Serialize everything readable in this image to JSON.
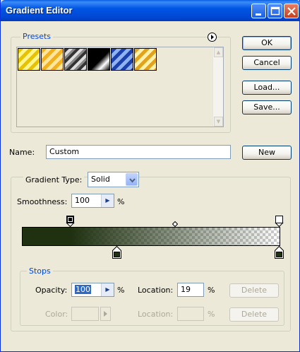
{
  "window": {
    "title": "Gradient Editor"
  },
  "presets": {
    "label": "Presets",
    "swatches": [
      {
        "name": "yellow-stripes"
      },
      {
        "name": "orange-stripes"
      },
      {
        "name": "silver-stripes"
      },
      {
        "name": "black-white"
      },
      {
        "name": "blue-stripes"
      },
      {
        "name": "gold-stripes"
      }
    ]
  },
  "buttons": {
    "ok": "OK",
    "cancel": "Cancel",
    "load": "Load...",
    "save": "Save...",
    "new": "New"
  },
  "name": {
    "label": "Name:",
    "value": "Custom"
  },
  "gradient": {
    "type_label": "Gradient Type:",
    "type_value": "Solid",
    "smoothness_label": "Smoothness:",
    "smoothness_value": "100",
    "smoothness_unit": "%",
    "color": "#1f3111"
  },
  "stops": {
    "label": "Stops",
    "opacity_label": "Opacity:",
    "opacity_value": "100",
    "opacity_unit": "%",
    "opacity_location_label": "Location:",
    "opacity_location_value": "19",
    "opacity_location_unit": "%",
    "delete_label": "Delete",
    "color_label": "Color:",
    "color_location_label": "Location:",
    "color_location_unit": "%",
    "color_delete_label": "Delete"
  }
}
